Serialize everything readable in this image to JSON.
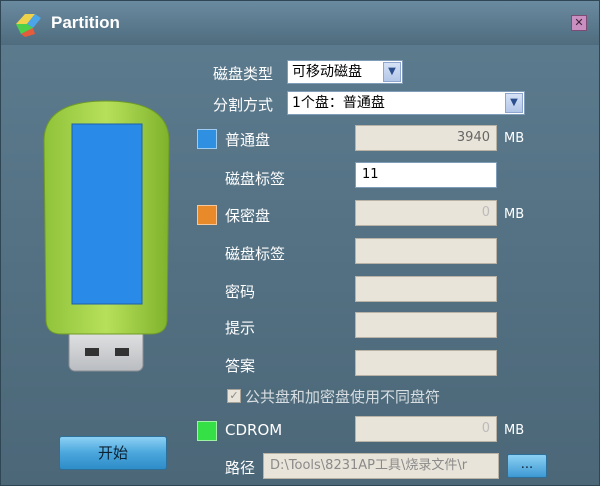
{
  "window": {
    "title": "Partition",
    "icons": {
      "app": "partition-app-icon",
      "close": "close-icon"
    }
  },
  "illustration": {
    "icon": "usb-drive-icon"
  },
  "form": {
    "disk_type": {
      "label": "磁盘类型",
      "value": "可移动磁盘"
    },
    "split_mode": {
      "label": "分割方式",
      "value": "1个盘：普通盘"
    },
    "normal_disk": {
      "label": "普通盘",
      "size": "3940",
      "unit": "MB",
      "color": "#2f8fe0",
      "tag_label": "磁盘标签",
      "tag_value": "11"
    },
    "secure_disk": {
      "label": "保密盘",
      "size": "0",
      "unit": "MB",
      "color": "#e8892a",
      "tag_label": "磁盘标签",
      "tag_value": "",
      "password_label": "密码",
      "hint_label": "提示",
      "answer_label": "答案"
    },
    "different_letter": {
      "label": "公共盘和加密盘使用不同盘符",
      "checked": true
    },
    "cdrom": {
      "label": "CDROM",
      "size": "0",
      "unit": "MB",
      "color": "#35e046",
      "path_label": "路径",
      "path_value": "D:\\Tools\\8231AP工具\\烧录文件\\r",
      "browse_label": "..."
    }
  },
  "actions": {
    "start_label": "开始"
  }
}
